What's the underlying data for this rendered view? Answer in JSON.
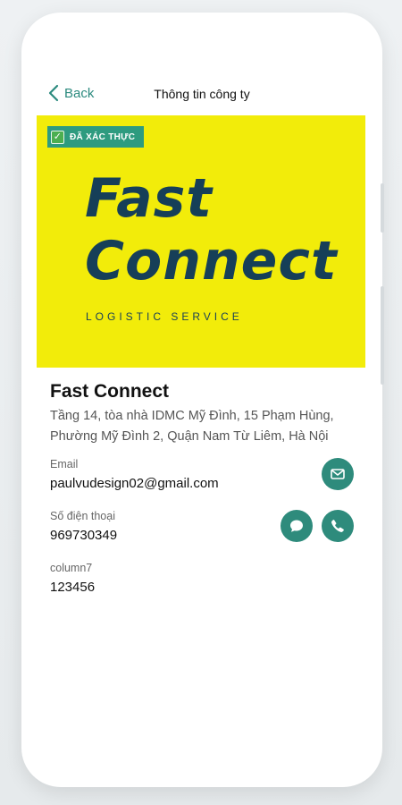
{
  "nav": {
    "back_label": "Back",
    "title": "Thông tin công ty"
  },
  "banner": {
    "badge": "ĐÃ XÁC THỰC",
    "logo_line1": "Fast",
    "logo_line2": "Connect",
    "logo_tagline": "LOGISTIC SERVICE",
    "background_color": "#f2ec0a",
    "logo_color": "#163f58"
  },
  "company": {
    "name": "Fast Connect",
    "address": "Tầng 14, tòa nhà IDMC Mỹ Đình, 15 Phạm Hùng, Phường Mỹ Đình 2, Quận Nam Từ Liêm, Hà Nội"
  },
  "fields": {
    "email": {
      "label": "Email",
      "value": "paulvudesign02@gmail.com"
    },
    "phone": {
      "label": "Số điện thoại",
      "value": "969730349"
    },
    "column7": {
      "label": "column7",
      "value": "123456"
    }
  },
  "actions": {
    "email_icon": "mail-icon",
    "chat_icon": "chat-icon",
    "call_icon": "phone-icon",
    "accent_color": "#2e8b7c"
  }
}
